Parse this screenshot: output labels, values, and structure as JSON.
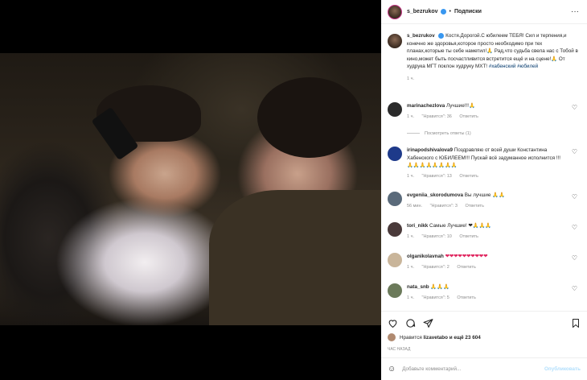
{
  "header": {
    "username": "s_bezrukov",
    "separator": "•",
    "follow_label": "Подписки",
    "more_label": "···"
  },
  "caption": {
    "username": "s_bezrukov",
    "text": "Костя.Дорогой.С юбилеем ТЕБЯ! Сил и терпения,и конечно же здоровья,которое просто необходимо при тех планах,которые ты себе наметил!🙏 Рад,что судьба свела нас с Тобой в кино,может быть посчастливится встретится ещё и на сцене!🙏 От худрука МГТ поклон худруку МХТ!",
    "hashtags": "#хабенский #юбилей",
    "time": "1 ч."
  },
  "comments": [
    {
      "username": "marinachezlova",
      "text": "Лучшие!!!🙏",
      "time": "1 ч.",
      "likes": "\"Нравится\": 36",
      "reply": "Ответить",
      "view_replies": "Посмотреть ответы (1)",
      "avatar_color": "#2b2b2b"
    },
    {
      "username": "irinapodshivalova9",
      "text": "Поздравляю от всей души Константина Хабенского с ЮБИЛЕЕМ!!! Пускай всё задуманное исполнится !!! 🙏🙏🙏🙏🙏🙏🙏🙏",
      "time": "1 ч.",
      "likes": "\"Нравится\": 13",
      "reply": "Ответить",
      "avatar_color": "#1e3a8a"
    },
    {
      "username": "evgeniia_skorodumova",
      "text": "Вы лучшие 🙏🙏",
      "time": "56 мин.",
      "likes": "\"Нравится\": 3",
      "reply": "Ответить",
      "avatar_color": "#5a6a7a"
    },
    {
      "username": "tori_nikk",
      "text": "Самые Лучшие! ❤🙏🙏🙏",
      "time": "1 ч.",
      "likes": "\"Нравится\": 10",
      "reply": "Ответить",
      "avatar_color": "#4a3a3a"
    },
    {
      "username": "olganikolavnah",
      "text": "❤❤❤❤❤❤❤❤❤❤",
      "time": "1 ч.",
      "likes": "\"Нравится\": 2",
      "reply": "Ответить",
      "avatar_color": "#c9b59a"
    },
    {
      "username": "nata_snb",
      "text": "🙏🙏🙏",
      "time": "1 ч.",
      "likes": "\"Нравится\": 5",
      "reply": "Ответить",
      "avatar_color": "#6b7a5a"
    }
  ],
  "likes": {
    "prefix": "Нравится",
    "user": "lizavetabo",
    "suffix": "и ещё 23 604"
  },
  "ago": "час назад",
  "add_comment": {
    "placeholder": "Добавьте комментарий...",
    "publish": "Опубликовать"
  },
  "colors": {
    "accent": "#3897f0",
    "publish_disabled": "#b2dffc",
    "hashtag": "#00376b",
    "muted": "#8e8e8e"
  }
}
